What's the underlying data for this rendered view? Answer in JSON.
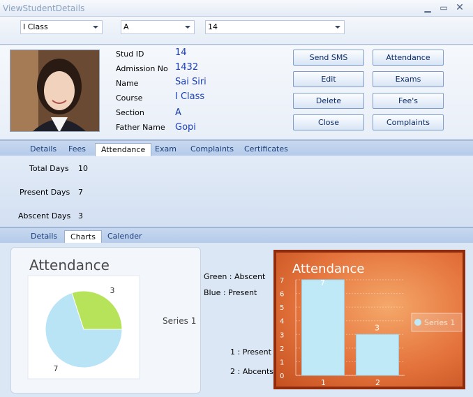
{
  "window": {
    "title": "ViewStudentDetails"
  },
  "filters": {
    "class": "I Class",
    "section": "A",
    "student_id": "14"
  },
  "student": {
    "fields": [
      {
        "label": "Stud ID",
        "value": "14"
      },
      {
        "label": "Admission No",
        "value": "1432"
      },
      {
        "label": "Name",
        "value": "Sai Siri"
      },
      {
        "label": "Course",
        "value": "I Class"
      },
      {
        "label": "Section",
        "value": "A"
      },
      {
        "label": "Father Name",
        "value": "Gopi"
      }
    ]
  },
  "actions": {
    "send_sms": "Send SMS",
    "attendance": "Attendance",
    "edit": "Edit",
    "exams": "Exams",
    "delete": "Delete",
    "fees": "Fee's",
    "close": "Close",
    "complaints": "Complaints"
  },
  "main_tabs": [
    "Details",
    "Fees",
    "Attendance",
    "Exam",
    "Complaints",
    "Certificates"
  ],
  "main_tab_active": "Attendance",
  "attendance": {
    "rows": [
      {
        "label": "Total Days",
        "value": "10"
      },
      {
        "label": "Present Days",
        "value": "7"
      },
      {
        "label": "Abscent Days",
        "value": "3"
      }
    ]
  },
  "sub_tabs": [
    "Details",
    "Charts",
    "Calender"
  ],
  "sub_tab_active": "Charts",
  "legend_notes": {
    "green": "Green : Abscent",
    "blue": "Blue : Present",
    "one": "1 : Present",
    "two": "2 : Abcents"
  },
  "colors": {
    "pie_present": "#b9e4f6",
    "pie_absent": "#b6e35a",
    "bar_fill": "#bfe9f7",
    "bar_card": "#e4733c"
  },
  "chart_data": [
    {
      "type": "pie",
      "title": "Attendance",
      "categories": [
        "Present",
        "Absent"
      ],
      "values": [
        7,
        3
      ],
      "data_labels": [
        "7",
        "3"
      ],
      "legend": [
        "Series 1"
      ],
      "legend_position": "right"
    },
    {
      "type": "bar",
      "title": "Attendance",
      "categories": [
        "1",
        "2"
      ],
      "series": [
        {
          "name": "Series 1",
          "values": [
            7,
            3
          ]
        }
      ],
      "ylim": [
        0,
        7
      ],
      "yticks": [
        "0",
        "1",
        "2",
        "3",
        "4",
        "5",
        "6",
        "7"
      ],
      "grid": true,
      "legend_position": "right"
    }
  ]
}
